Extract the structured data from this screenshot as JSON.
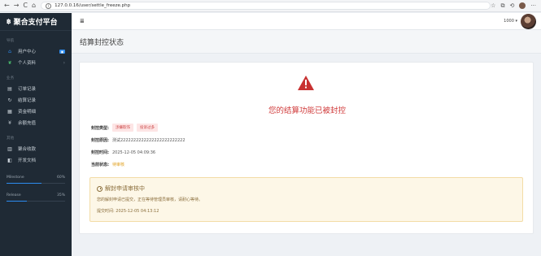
{
  "browser": {
    "url": "127.0.0.16/user/settle_freeze.php",
    "back_icon": "←",
    "forward_icon": "→",
    "reload_icon": "C",
    "home_icon": "⌂",
    "info_icon": "i",
    "star_icon": "☆",
    "more_icon": "···"
  },
  "sidebar": {
    "brand": "聚合支付平台",
    "brand_icon": "฿",
    "sections": {
      "main": "导航",
      "business": "业务",
      "other": "其他"
    },
    "items": [
      {
        "label": "用户中心",
        "icon": "home-icon"
      },
      {
        "label": "个人资料",
        "icon": "leaf-icon"
      },
      {
        "label": "订单记录",
        "icon": "list-icon"
      },
      {
        "label": "结算记录",
        "icon": "settle-icon"
      },
      {
        "label": "资金明细",
        "icon": "ledger-icon"
      },
      {
        "label": "余额充值",
        "icon": "yen-icon"
      },
      {
        "label": "聚合收款",
        "icon": "qr-icon"
      },
      {
        "label": "开发文档",
        "icon": "book-icon"
      }
    ],
    "milestone": {
      "label": "Milestone",
      "value": "60%",
      "progress": 0.6
    },
    "release": {
      "label": "Release",
      "value": "35%",
      "progress": 0.35
    }
  },
  "header": {
    "balance": "1000 ▾"
  },
  "page": {
    "title": "结算封控状态"
  },
  "status": {
    "message": "您的结算功能已被封控",
    "type_label": "封控类型:",
    "tags": [
      "涉嫌欺诈",
      "投诉过多"
    ],
    "reason_label": "封控原因:",
    "reason": "测试2222222222222222222222222",
    "time_label": "封控时间:",
    "time": "2025-12-05 04:09:36",
    "state_label": "当前状态:",
    "state": "待审核"
  },
  "notice": {
    "title": "解封申请审核中",
    "desc": "您的解封申请已提交，正在等待管理员审核，请耐心等待。",
    "submit_label": "提交时间:",
    "submit_time": "2025-12-05 04:13:12"
  },
  "colors": {
    "sidebar_bg": "#1f2a35",
    "accent": "#2d8cf0",
    "danger": "#d03b3b",
    "warning": "#e0a01e",
    "notice_bg": "#fdf7e7"
  }
}
